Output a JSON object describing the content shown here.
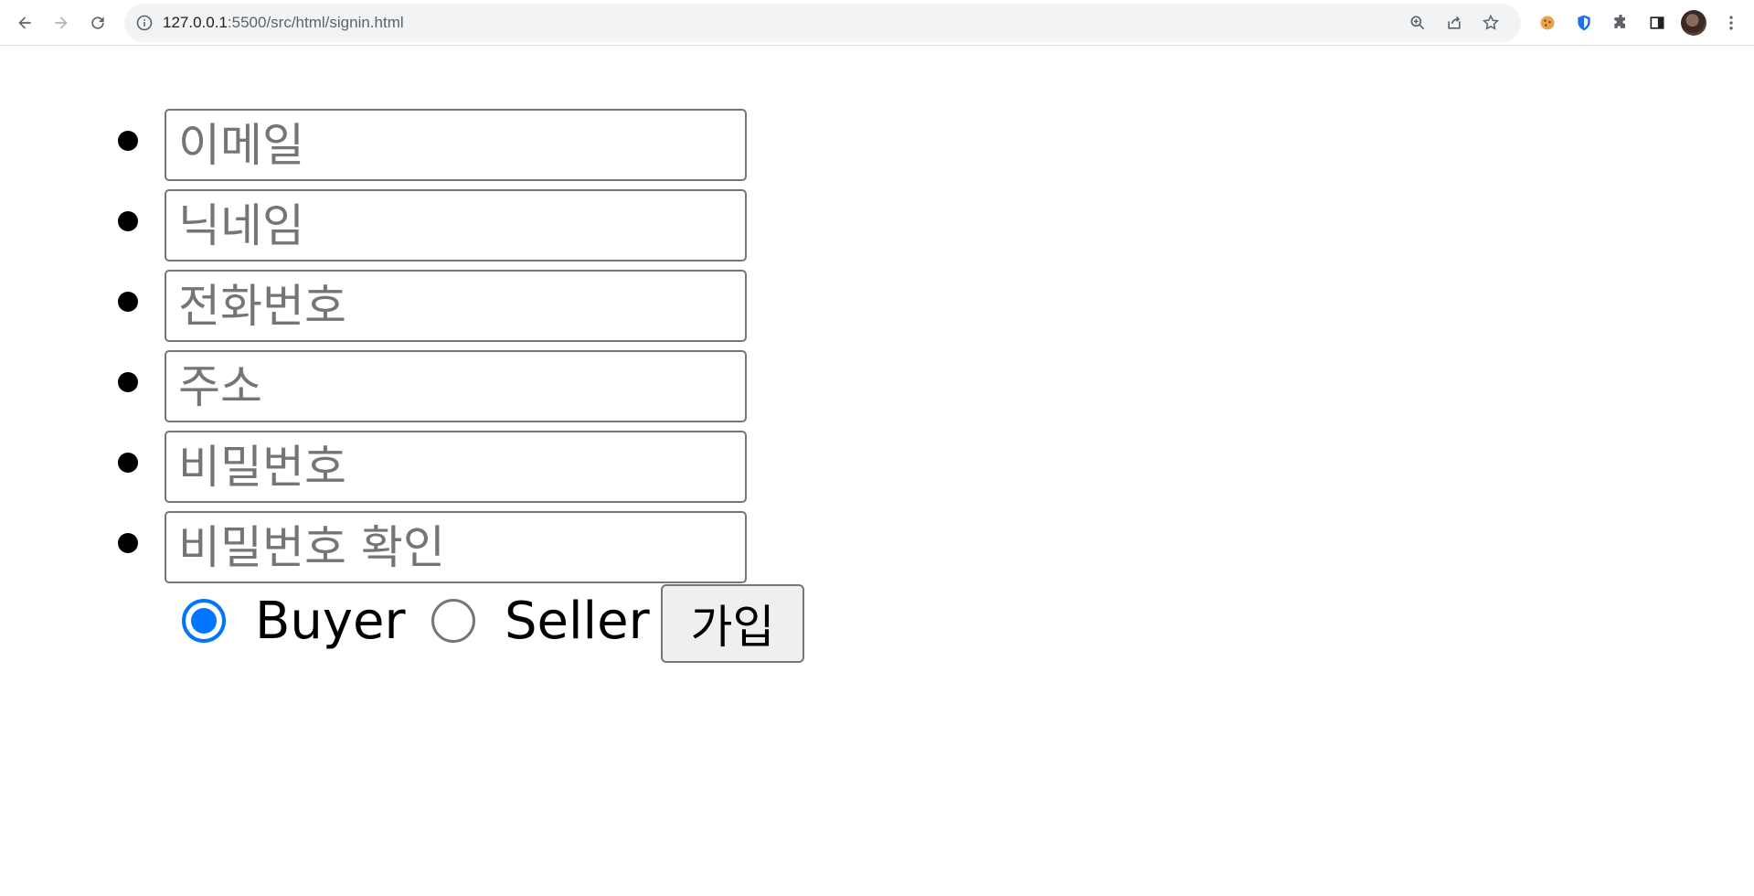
{
  "browser": {
    "url_host": "127.0.0.1",
    "url_rest": ":5500/src/html/signin.html",
    "icons": [
      "back-icon",
      "forward-icon",
      "reload-icon",
      "site-info-icon",
      "zoom-icon",
      "share-icon",
      "bookmark-star-icon",
      "cookie-extension-icon",
      "shield-extension-icon",
      "extensions-puzzle-icon",
      "side-panel-icon",
      "profile-avatar",
      "more-menu-icon"
    ]
  },
  "form": {
    "fields": [
      {
        "placeholder": "이메일"
      },
      {
        "placeholder": "닉네임"
      },
      {
        "placeholder": "전화번호"
      },
      {
        "placeholder": "주소"
      },
      {
        "placeholder": "비밀번호"
      },
      {
        "placeholder": "비밀번호 확인"
      }
    ],
    "roles": [
      {
        "label": "Buyer",
        "checked": true
      },
      {
        "label": "Seller",
        "checked": false
      }
    ],
    "submit_label": "가입"
  },
  "colors": {
    "radio_accent": "#0075ff",
    "input_border": "#767676"
  }
}
